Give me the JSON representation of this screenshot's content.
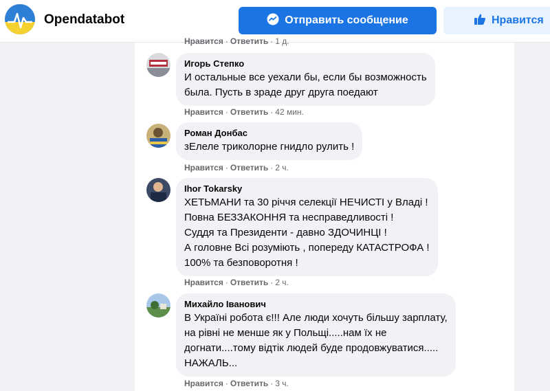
{
  "header": {
    "page_name": "Opendatabot",
    "message_button_label": "Отправить сообщение",
    "like_button_label": "Нравится",
    "accent_color": "#1b74e4"
  },
  "actions": {
    "like": "Нравится",
    "reply": "Ответить",
    "separator": "·"
  },
  "top_meta": {
    "time": "1 д."
  },
  "comments": [
    {
      "author": "Игорь Степко",
      "lines": [
        "И остальные все уехали бы, если бы возможность",
        "была. Пусть в зраде друг друга поедают"
      ],
      "time": "42 мин."
    },
    {
      "author": "Роман Донбас",
      "lines": [
        "зЕлеле триколорне гнидло рулить !"
      ],
      "time": "2 ч."
    },
    {
      "author": "Ihor Tokarsky",
      "lines": [
        "ХЕТЬМАНИ та 30 річчя селекції НЕЧИСТІ у Владі !",
        "Повна БЕЗЗАКОННЯ та несправедливості !",
        "Суддя та Президенти - давно ЗДОЧИНЦІ !",
        "А головне Всі розуміють , попереду КАТАСТРОФА !",
        "100% та безповоротня !"
      ],
      "time": "2 ч."
    },
    {
      "author": "Михайло Іванович",
      "lines": [
        "В Україні робота є!!! Але люди хочуть більшу зарплату,",
        "на рівні не менше як у Польщі.....нам їх не",
        "догнати....тому відтік людей буде продовжуватися.....",
        "НАЖАЛЬ..."
      ],
      "time": "3 ч."
    }
  ]
}
